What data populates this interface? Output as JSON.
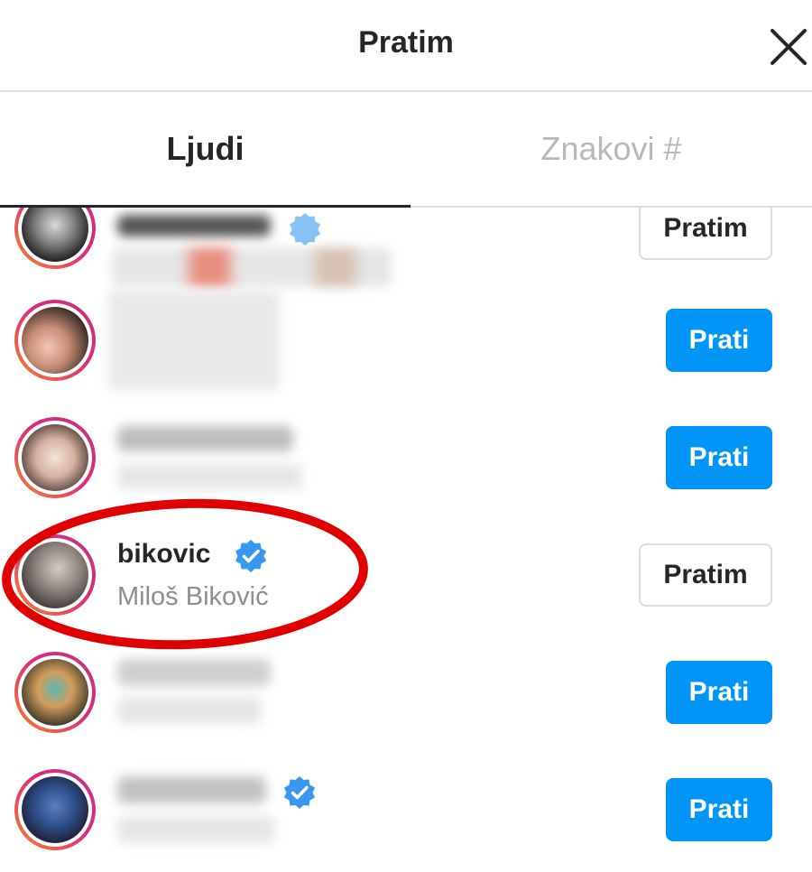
{
  "header": {
    "title": "Pratim"
  },
  "tabs": [
    {
      "label": "Ljudi",
      "active": true
    },
    {
      "label": "Znakovi #",
      "active": false
    }
  ],
  "users": [
    {
      "username": "",
      "full_name": "",
      "verified": true,
      "button_label": "Pratim",
      "button_style": "following"
    },
    {
      "username": "",
      "full_name": "",
      "verified": false,
      "button_label": "Prati",
      "button_style": "follow"
    },
    {
      "username": "",
      "full_name": "",
      "verified": false,
      "button_label": "Prati",
      "button_style": "follow"
    },
    {
      "username": "bikovic",
      "full_name": "Miloš Biković",
      "verified": true,
      "button_label": "Pratim",
      "button_style": "following",
      "highlighted": true
    },
    {
      "username": "",
      "full_name": "",
      "verified": false,
      "button_label": "Prati",
      "button_style": "follow"
    },
    {
      "username": "",
      "full_name": "",
      "verified": true,
      "button_label": "Prati",
      "button_style": "follow"
    }
  ],
  "colors": {
    "follow_blue": "#0095f6",
    "verified_blue": "#3897f0",
    "highlight_red": "#e00000",
    "story_ring_start": "#f58529",
    "story_ring_end": "#c13584"
  },
  "icons": {
    "close": "close-icon",
    "verified": "verified-badge-icon"
  }
}
